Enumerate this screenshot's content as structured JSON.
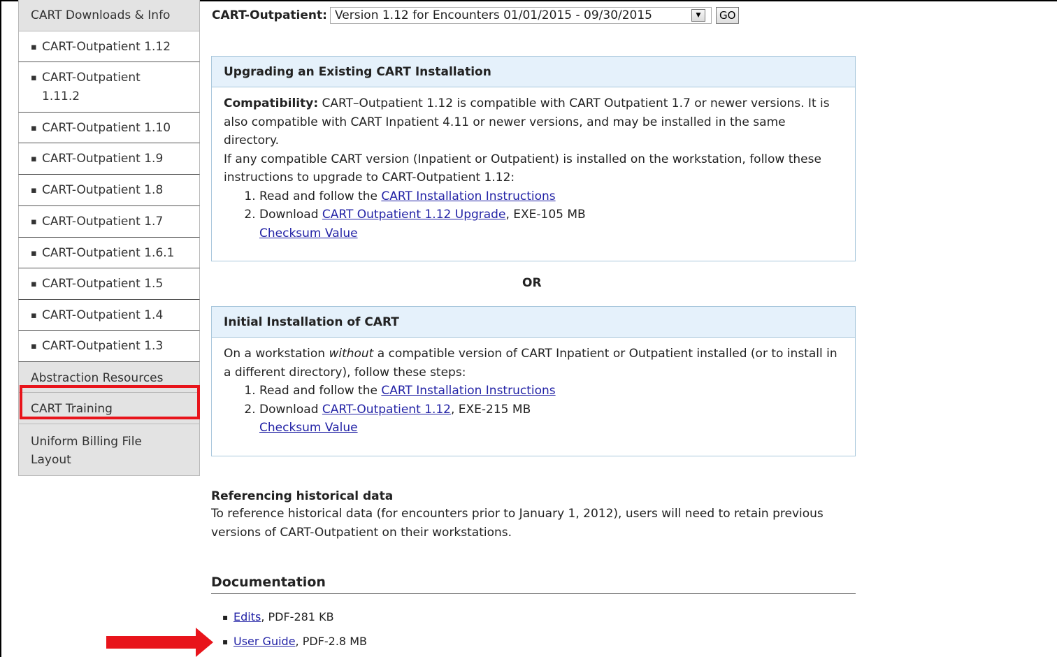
{
  "sidebar": {
    "header_downloads": "CART Downloads & Info",
    "items": [
      "CART-Outpatient 1.12",
      "CART-Outpatient 1.11.2",
      "CART-Outpatient 1.10",
      "CART-Outpatient 1.9",
      "CART-Outpatient 1.8",
      "CART-Outpatient 1.7",
      "CART-Outpatient 1.6.1",
      "CART-Outpatient 1.5",
      "CART-Outpatient 1.4",
      "CART-Outpatient 1.3"
    ],
    "abstraction": "Abstraction Resources",
    "training": "CART Training",
    "billing": "Uniform Billing File Layout"
  },
  "selector": {
    "label": "CART-Outpatient:",
    "value": "Version 1.12 for Encounters 01/01/2015 - 09/30/2015",
    "go": "GO"
  },
  "upgrade": {
    "title": "Upgrading an Existing CART Installation",
    "compat_label": "Compatibility:",
    "compat_text": " CART–Outpatient 1.12 is compatible with CART Outpatient 1.7 or newer versions. It is also compatible with CART Inpatient 4.11 or newer versions, and may be installed in the same directory.",
    "intro": "If any compatible CART version (Inpatient or Outpatient) is installed on the workstation, follow these instructions to upgrade to CART-Outpatient 1.12:",
    "step1_pre": "Read and follow the ",
    "step1_link": "CART Installation Instructions",
    "step2_pre": "Download ",
    "step2_link": "CART Outpatient 1.12 Upgrade",
    "step2_post": ", EXE-105 MB",
    "checksum": "Checksum Value"
  },
  "or_text": "OR",
  "initial": {
    "title": "Initial Installation of CART",
    "text_pre": "On a workstation ",
    "text_em": "without",
    "text_post": " a compatible version of CART Inpatient or Outpatient installed (or to install in a different directory), follow these steps:",
    "step1_pre": "Read and follow the ",
    "step1_link": "CART Installation Instructions",
    "step2_pre": "Download ",
    "step2_link": "CART-Outpatient 1.12",
    "step2_post": ", EXE-215 MB",
    "checksum": "Checksum Value"
  },
  "historical": {
    "title": "Referencing historical data",
    "text": "To reference historical data (for encounters prior to January 1, 2012), users will need to retain previous versions of CART-Outpatient on their workstations."
  },
  "documentation": {
    "title": "Documentation",
    "items": [
      {
        "link": "Edits",
        "post": ", PDF-281 KB"
      },
      {
        "link": "User Guide",
        "post": ", PDF-2.8 MB"
      }
    ]
  },
  "colors": {
    "highlight_red": "#e8141b",
    "link_blue": "#2323a6",
    "panel_header_bg": "#e5f1fb"
  }
}
